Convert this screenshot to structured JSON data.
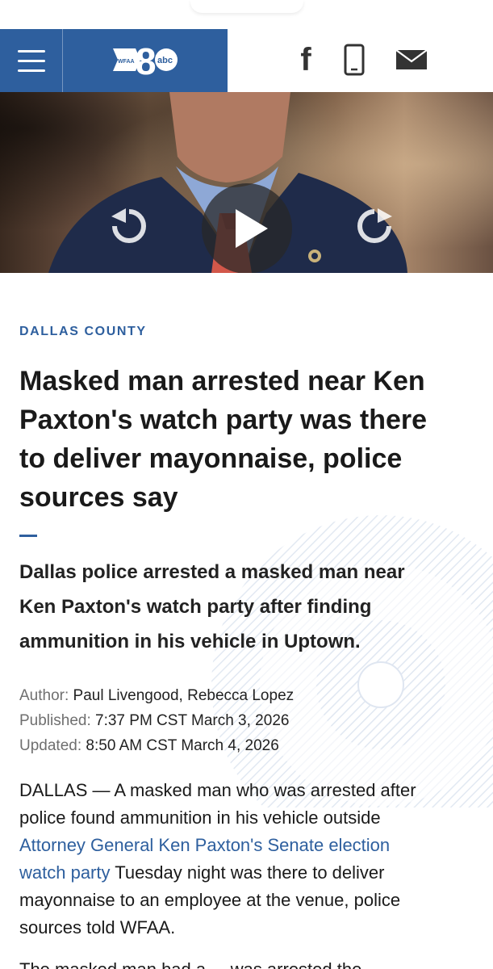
{
  "header": {
    "logo_text": "WFAA",
    "logo_number": "8",
    "logo_network": "abc",
    "icons": [
      "menu-icon",
      "facebook-icon",
      "phone-icon",
      "mail-icon"
    ]
  },
  "video": {
    "controls": [
      "rewind-icon",
      "play-icon",
      "forward-icon"
    ]
  },
  "article": {
    "section": "DALLAS COUNTY",
    "headline_lines": [
      "Masked man arrested near Ken",
      "Paxton's watch party was there",
      "to deliver mayonnaise, police",
      "sources say"
    ],
    "summary_lines": [
      "Dallas police arrested a masked man near",
      "Ken Paxton's watch party after finding",
      "ammunition in his vehicle in Uptown."
    ],
    "author_label": "Author:",
    "author": "Paul Livengood, Rebecca Lopez",
    "published_label": "Published:",
    "published": "7:37 PM CST March 3, 2026",
    "updated_label": "Updated:",
    "updated": "8:50 AM CST March 4, 2026",
    "body": {
      "line1": "DALLAS — A masked man who was arrested after",
      "line2": "police found ammunition in his vehicle outside",
      "link_line1": "Attorney General Ken Paxton's Senate election",
      "link_line2": "watch party",
      "after_link": " Tuesday night was there to deliver",
      "line5": "mayonnaise to an employee at the venue, police",
      "line6": "sources told WFAA.",
      "next_partial": "The masked man had a ... was arrested the"
    }
  },
  "colors": {
    "brand_blue": "#2e5f9e",
    "text": "#1a1a1a",
    "meta_label": "#6f6f6f"
  }
}
